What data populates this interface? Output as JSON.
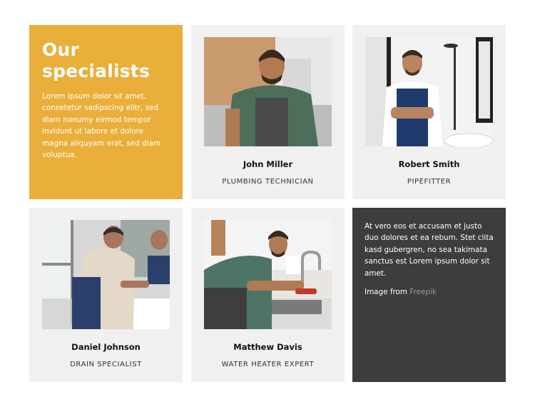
{
  "intro": {
    "title_line1": "Our",
    "title_line2": "specialists",
    "body": "Lorem ipsum dolor sit amet, consetetur sadipscing elitr, sed diam nonumy eirmod tempor invidunt ut labore et dolore magna aliquyam erat, sed diam voluptua."
  },
  "specialists": [
    {
      "name": "John Miller",
      "role": "PLUMBING TECHNICIAN"
    },
    {
      "name": "Robert Smith",
      "role": "PIPEFITTER"
    },
    {
      "name": "Daniel Johnson",
      "role": "DRAIN SPECIALIST"
    },
    {
      "name": "Matthew Davis",
      "role": "WATER HEATER EXPERT"
    }
  ],
  "note": {
    "body": "At vero eos et accusam et justo duo dolores et ea rebum. Stet clita kasd gubergren, no sea takimata sanctus est Lorem ipsum dolor sit amet.",
    "credit_prefix": "Image from",
    "credit_link": "Freepik"
  },
  "colors": {
    "accent": "#e9af3a",
    "card_bg": "#f0f0f0",
    "dark_bg": "#3d3d3d",
    "link": "#9a9a9a"
  }
}
